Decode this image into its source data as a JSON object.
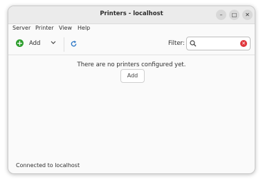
{
  "window": {
    "title": "Printers - localhost"
  },
  "menubar": {
    "items": [
      "Server",
      "Printer",
      "View",
      "Help"
    ]
  },
  "toolbar": {
    "add_label": "Add",
    "filter_label": "Filter:",
    "filter_value": ""
  },
  "main": {
    "empty_message": "There are no printers configured yet.",
    "add_button_label": "Add"
  },
  "statusbar": {
    "text": "Connected to localhost"
  },
  "colors": {
    "add_icon": "#2e9e2e",
    "refresh_icon": "#2a76c6",
    "clear_icon": "#e0353b"
  },
  "icons": [
    "add-icon",
    "chevron-down-icon",
    "refresh-icon",
    "search-icon",
    "clear-icon",
    "minimize-icon",
    "maximize-icon",
    "close-icon"
  ]
}
